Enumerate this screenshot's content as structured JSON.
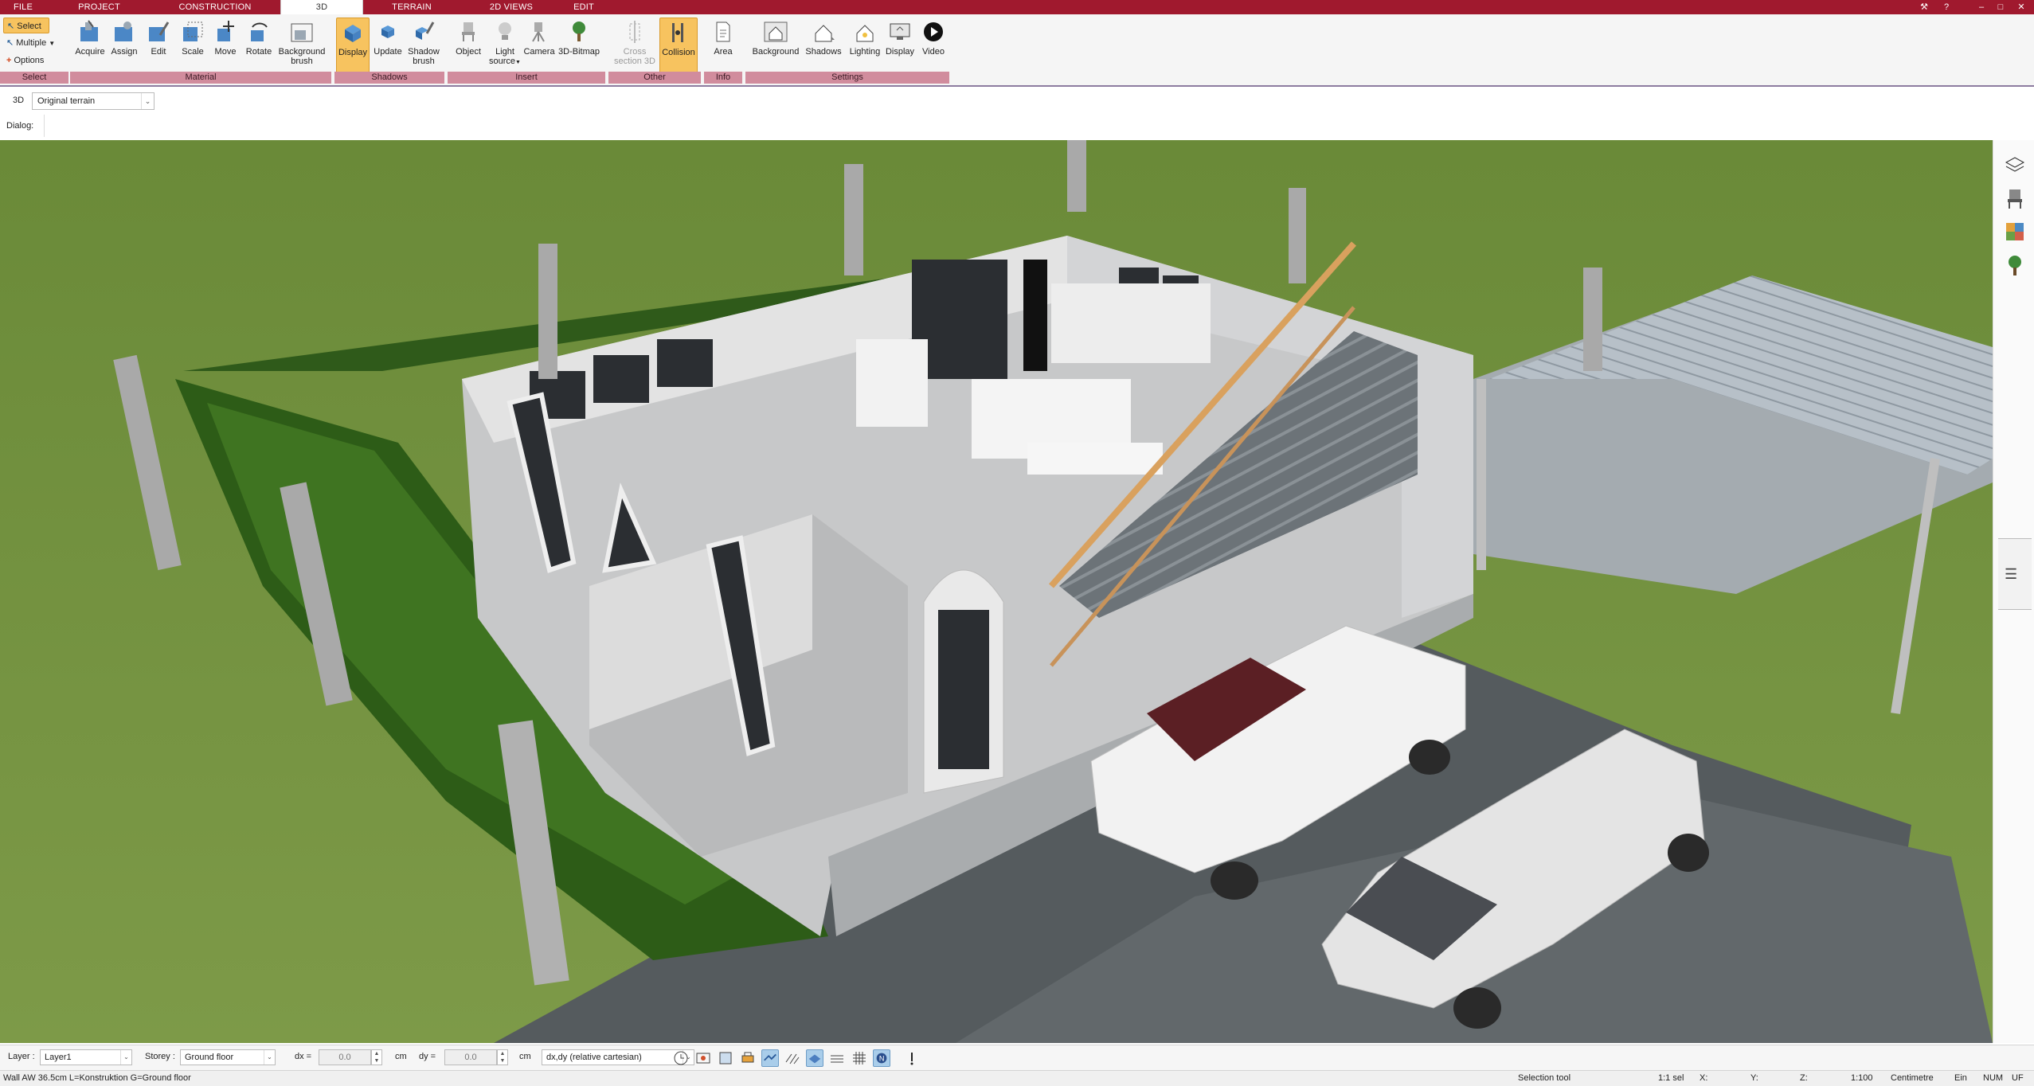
{
  "tabs": [
    {
      "label": "FILE"
    },
    {
      "label": "PROJECT"
    },
    {
      "label": "CONSTRUCTION"
    },
    {
      "label": "3D"
    },
    {
      "label": "TERRAIN"
    },
    {
      "label": "2D VIEWS"
    },
    {
      "label": "EDIT"
    }
  ],
  "ribbon": {
    "select": {
      "select_label": "Select",
      "multiple_label": "Multiple",
      "options_label": "Options",
      "group": "Select"
    },
    "material": {
      "acquire": "Acquire",
      "assign": "Assign",
      "edit": "Edit",
      "scale": "Scale",
      "move": "Move",
      "rotate": "Rotate",
      "background_brush_1": "Background",
      "background_brush_2": "brush",
      "group": "Material"
    },
    "shadows": {
      "display": "Display",
      "update": "Update",
      "shadow_brush_1": "Shadow",
      "shadow_brush_2": "brush",
      "group": "Shadows"
    },
    "insert": {
      "object": "Object",
      "light_source_1": "Light",
      "light_source_2": "source",
      "camera": "Camera",
      "bitmap": "3D-Bitmap",
      "group": "Insert"
    },
    "other": {
      "cross_section_1": "Cross",
      "cross_section_2": "section 3D",
      "collision": "Collision",
      "group": "Other"
    },
    "info": {
      "area": "Area",
      "group": "Info"
    },
    "settings": {
      "background": "Background",
      "shadows": "Shadows",
      "lighting": "Lighting",
      "display": "Display",
      "video": "Video",
      "group": "Settings"
    }
  },
  "viewbar": {
    "mode": "3D",
    "terrain_select": "Original terrain"
  },
  "dialogbar": {
    "label": "Dialog:"
  },
  "bottombar": {
    "layer_label": "Layer :",
    "layer_value": "Layer1",
    "storey_label": "Storey :",
    "storey_value": "Ground floor",
    "dx_label": "dx =",
    "dx_value": "0.0",
    "dx_unit": "cm",
    "dy_label": "dy =",
    "dy_value": "0.0",
    "dy_unit": "cm",
    "coord_mode": "dx,dy (relative cartesian)"
  },
  "statusbar": {
    "info": "Wall AW 36.5cm L=Konstruktion G=Ground floor",
    "tool": "Selection tool",
    "selection": "1:1 sel",
    "x": "X:",
    "y": "Y:",
    "z": "Z:",
    "scale": "1:100",
    "unit": "Centimetre",
    "ein": "Ein",
    "num": "NUM",
    "uf": "UF"
  },
  "colors": {
    "tabbar": "#a0192e",
    "ribbon_group": "#d18c9d",
    "active_button": "#f7c35f",
    "grass": "#6f8a3c",
    "pavement": "#5a5a5a"
  },
  "icons": [
    "select-arrow-icon",
    "multiple-icon",
    "options-plus-icon",
    "acquire-icon",
    "assign-icon",
    "edit-brush-icon",
    "scale-icon",
    "move-icon",
    "rotate-icon",
    "background-brush-icon",
    "display-shadow-icon",
    "update-icon",
    "shadow-brush-icon",
    "object-chair-icon",
    "light-bulb-icon",
    "camera-icon",
    "tree-bitmap-icon",
    "cross-section-icon",
    "collision-icon",
    "area-icon",
    "background-house-icon",
    "shadows-house-icon",
    "lighting-house-icon",
    "display-monitor-icon",
    "video-play-icon",
    "layers-icon",
    "chair-icon",
    "palette-icon",
    "tree-icon",
    "menu-lines-icon"
  ]
}
